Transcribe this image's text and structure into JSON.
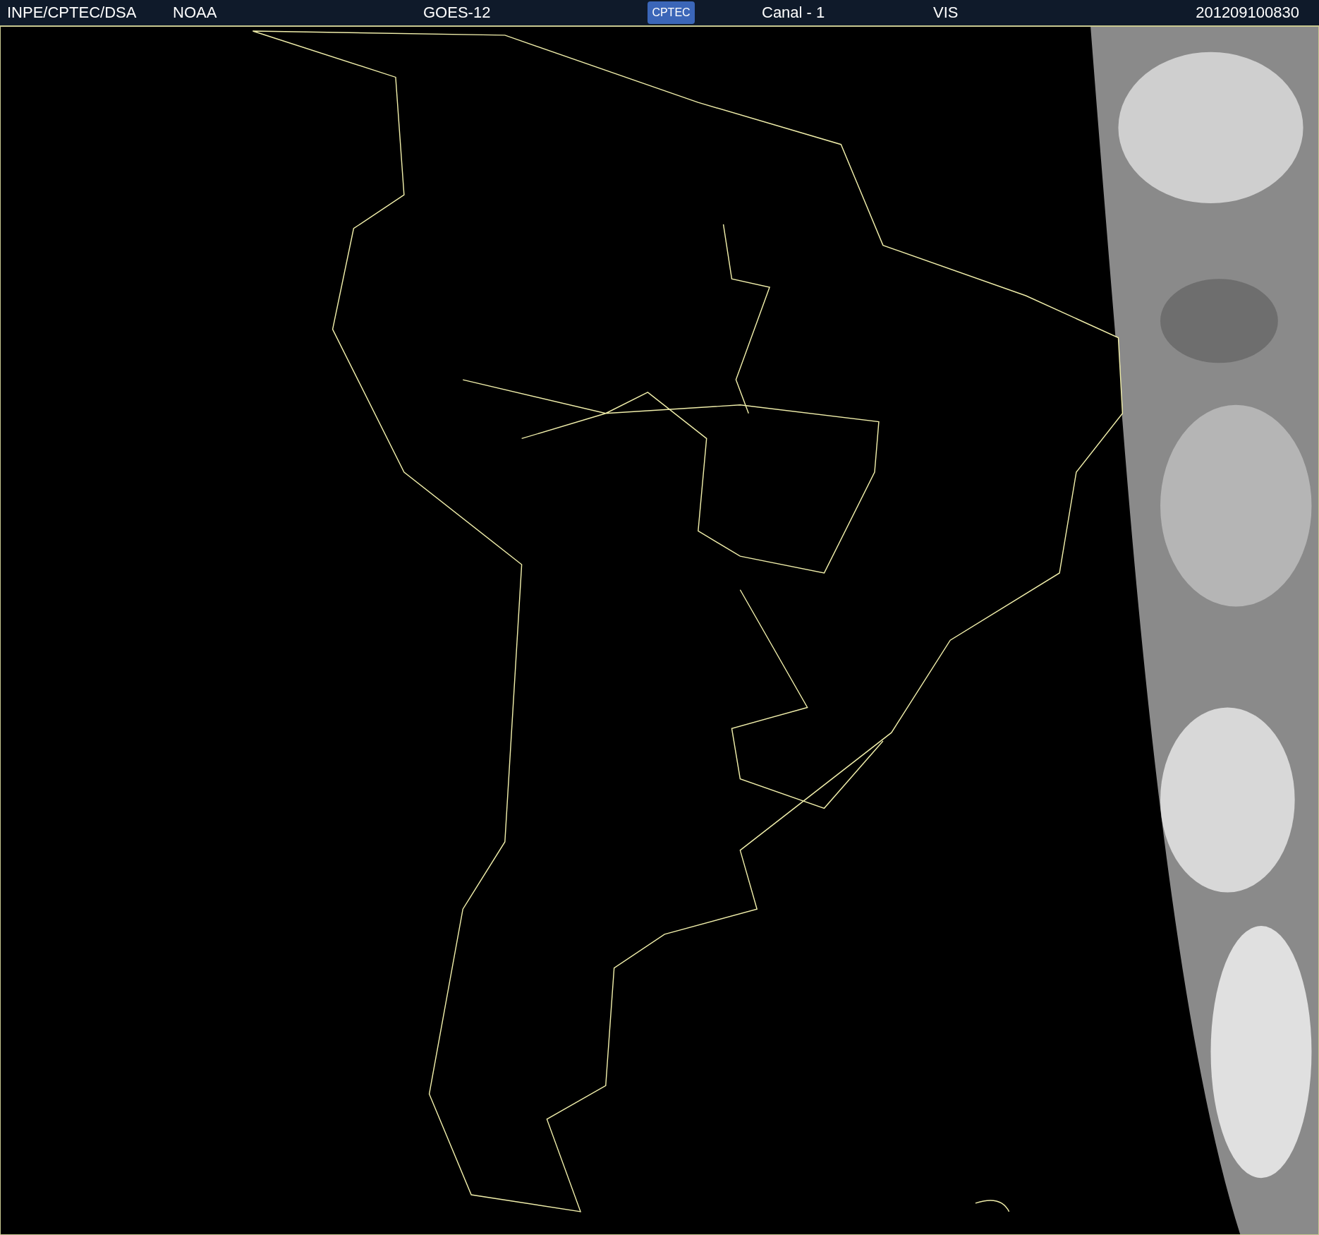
{
  "header": {
    "items": [
      "INPE/CPTEC/DSA",
      "NOAA",
      "GOES-12"
    ],
    "logo": "CPTEC",
    "channel": "Canal - 1",
    "band": "VIS",
    "timestamp": "201209100830"
  }
}
